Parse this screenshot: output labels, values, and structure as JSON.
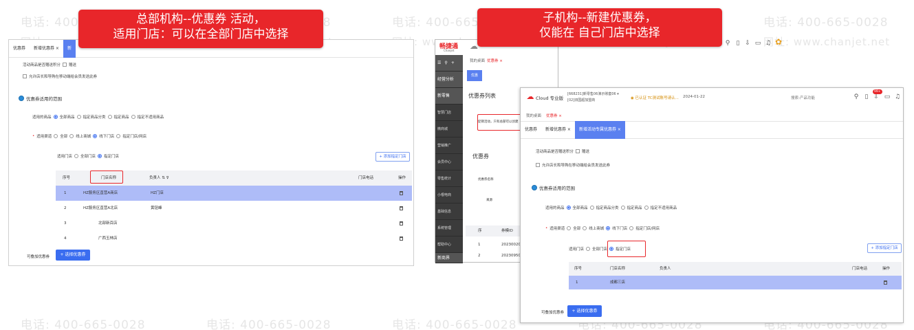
{
  "watermark": {
    "phone": "电话: 400-665-0028",
    "site": "网址: www.chanjet.net"
  },
  "left": {
    "banner_line1": "总部机构--优惠券 活动，",
    "banner_line2": "适用门店：可以在全部门店中选择",
    "tabs": [
      "优惠券",
      "新增优惠券 ×",
      "新"
    ],
    "points_label": "活动商品是否赠送积分",
    "points_option": "赠送",
    "allow_label": "允许店长和导购在移动端给会员发送此券",
    "scope_title": "优惠券适用的范围",
    "goods_label": "适用的商品",
    "goods_options": [
      "全部商品",
      "指定商品分类",
      "指定商品",
      "指定不适用商品"
    ],
    "channel_label": "适用渠道",
    "channel_options": [
      "全部",
      "线上商城",
      "线下门店",
      "指定门店/网店"
    ],
    "store_label": "适用门店",
    "store_options": [
      "全部门店",
      "指定门店"
    ],
    "add_store_btn": "+ 添加指定门店",
    "table_headers": [
      "序号",
      "门店名称",
      "负责人 ⇅ ⊽",
      "门店电话",
      "操作"
    ],
    "rows": [
      {
        "no": "1",
        "name": "HZ服务区直营A商店",
        "owner": "HZ门店"
      },
      {
        "no": "2",
        "name": "HZ服务区直营A北店",
        "owner": "黄钮峰"
      },
      {
        "no": "3",
        "name": "北部新百店",
        "owner": ""
      },
      {
        "no": "4",
        "name": "广西玉林店",
        "owner": ""
      }
    ],
    "stack_label": "可叠加优惠券",
    "choose_btn": "+ 选择优惠券"
  },
  "right": {
    "banner_line1": "子机构--新建优惠券，",
    "banner_line2": "仅能在 自己门店中选择",
    "brand": "畅捷通",
    "brand_sub": "Chanjet",
    "back_tabs": [
      "我的桌面",
      "优惠券 ×"
    ],
    "back_sub_tab": "优惠",
    "back_top_btns": [
      "经营分析",
      "新零售"
    ],
    "sidebar_items": [
      "智慧门店",
      "微商城",
      "营销推广",
      "会员中心",
      "零售统计",
      "小根电商",
      "基础信息",
      "系统管理",
      "帮助中心",
      "新商界"
    ],
    "back_list_title": "优惠券列表",
    "back_notice": "促销活动，只有总部可以创建",
    "back_coupon_title": "优惠券",
    "back_coupon_name_label": "优惠券名称",
    "back_source_label": "来源",
    "back_table_headers": [
      "序",
      "券模ID"
    ],
    "back_rows": [
      {
        "no": "1",
        "id": "20230020..."
      },
      {
        "no": "2",
        "id": "20230950..."
      }
    ],
    "cloud_label": "Cloud 专业版",
    "org_line1": "[668231]新零售06演示账套06 ▾",
    "org_line2": "[02]旧国超加盟商",
    "cert_text": "◉ 已认证 TC测试账号请认...",
    "date_text": "2024-01-22",
    "search_placeholder": "搜索-产品功能",
    "badge_count": "99+",
    "front_tabs": [
      "我的桌面",
      "优惠券 ×"
    ],
    "front_sub_tabs": [
      "优惠券",
      "新增优惠券 ×",
      "新增活动专属优惠券 ×"
    ],
    "points_label": "活动商品是否赠送积分",
    "points_option": "赠送",
    "allow_label": "允许店长和导购在移动端给会员发送此券",
    "scope_title": "优惠券适用的范围",
    "goods_label": "适用的商品",
    "goods_options": [
      "全部商品",
      "指定商品分类",
      "指定商品",
      "指定不适用商品"
    ],
    "channel_label": "适用渠道",
    "channel_options": [
      "全部",
      "线上商城",
      "线下门店",
      "指定门店/网店"
    ],
    "store_label": "适用门店",
    "store_options": [
      "全部门店",
      "指定门店"
    ],
    "add_store_btn": "+ 添加指定门店",
    "table_headers": [
      "序号",
      "门店名称",
      "负责人",
      "门店电话",
      "操作"
    ],
    "rows": [
      {
        "no": "1",
        "name": "成都三店",
        "owner": ""
      }
    ],
    "stack_label": "可叠加优惠券",
    "choose_btn": "+ 选择优惠券"
  }
}
